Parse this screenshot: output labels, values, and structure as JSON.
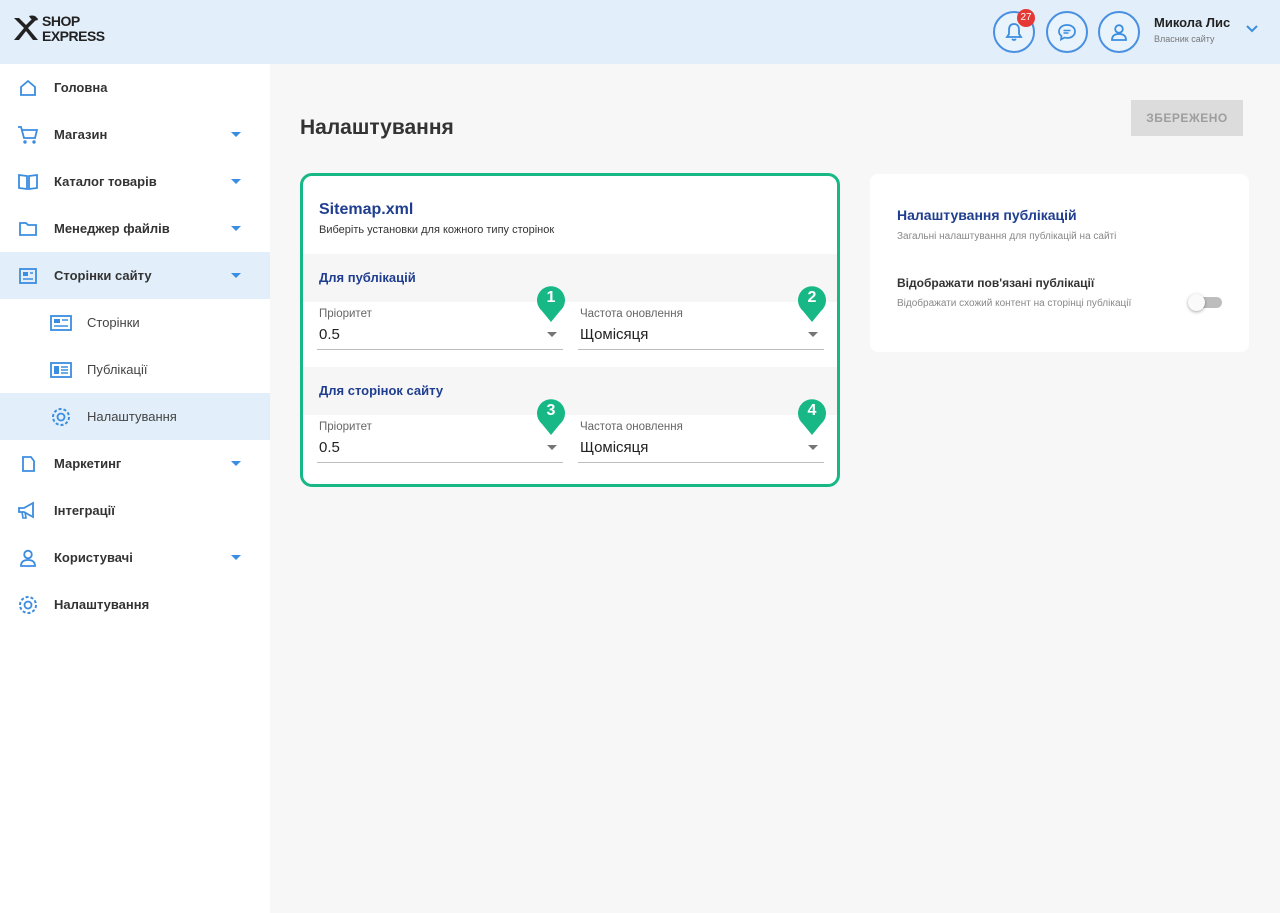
{
  "header": {
    "logo_line1": "SHOP",
    "logo_line2": "EXPRESS",
    "notification_count": "27",
    "user_name": "Микола Лис",
    "user_role": "Власник сайту"
  },
  "sidebar": {
    "items": [
      {
        "label": "Головна",
        "icon": "home-icon"
      },
      {
        "label": "Магазин",
        "icon": "cart-icon"
      },
      {
        "label": "Каталог товарів",
        "icon": "catalog-icon"
      },
      {
        "label": "Менеджер файлів",
        "icon": "folder-icon"
      },
      {
        "label": "Сторінки сайту",
        "icon": "pages-icon"
      },
      {
        "label": "Сторінки",
        "icon": "page-icon"
      },
      {
        "label": "Публікації",
        "icon": "publications-icon"
      },
      {
        "label": "Налаштування",
        "icon": "gear-icon"
      },
      {
        "label": "Маркетинг",
        "icon": "marketing-icon"
      },
      {
        "label": "Інтеграції",
        "icon": "megaphone-icon"
      },
      {
        "label": "Користувачі",
        "icon": "user-icon"
      },
      {
        "label": "Налаштування",
        "icon": "gear-icon"
      }
    ]
  },
  "main": {
    "title": "Налаштування",
    "save_label": "ЗБЕРЕЖЕНО"
  },
  "sitemap": {
    "title": "Sitemap.xml",
    "subtitle": "Виберіть установки для кожного типу сторінок",
    "sections": [
      {
        "title": "Для публікацій",
        "priority_label": "Пріоритет",
        "priority_value": "0.5",
        "frequency_label": "Частота оновлення",
        "frequency_value": "Щомісяця",
        "markers": [
          "1",
          "2"
        ]
      },
      {
        "title": "Для сторінок сайту",
        "priority_label": "Пріоритет",
        "priority_value": "0.5",
        "frequency_label": "Частота оновлення",
        "frequency_value": "Щомісяця",
        "markers": [
          "3",
          "4"
        ]
      }
    ]
  },
  "publications": {
    "title": "Налаштування публікацій",
    "subtitle": "Загальні налаштування для публікацій на сайті",
    "toggle_label": "Відображати пов'язані публікації",
    "toggle_desc": "Відображати схожий контент на сторінці публікації",
    "toggle_on": false
  },
  "colors": {
    "accent": "#3b8de0",
    "title_blue": "#1f3e8f",
    "highlight_green": "#17b886",
    "header_bg": "#e2effa"
  }
}
